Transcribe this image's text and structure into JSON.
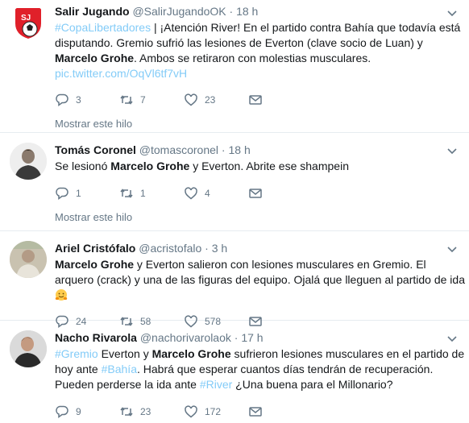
{
  "tweets": [
    {
      "name": "Salir Jugando",
      "handle": "@SalirJugandoOK",
      "sep": "·",
      "time": "18 h",
      "hashtag1": "#CopaLibertadores",
      "t1": " | ¡Atención River! En el partido contra Bahía que todavía está disputando. Gremio sufrió las lesiones de Everton (clave socio de Luan) y ",
      "bold1": "Marcelo Grohe",
      "t2": ". Ambos se retiraron con molestias musculares. ",
      "link": "pic.twitter.com/OqVl6tf7vH",
      "replies": "3",
      "retweets": "7",
      "likes": "23",
      "show_thread": "Mostrar este hilo",
      "avatar_text": "SJ"
    },
    {
      "name": "Tomás Coronel",
      "handle": "@tomascoronel",
      "sep": "·",
      "time": "18 h",
      "t1": "Se lesionó ",
      "bold1": "Marcelo Grohe",
      "t2": " y Everton. Abrite ese shampein",
      "replies": "1",
      "retweets": "1",
      "likes": "4",
      "show_thread": "Mostrar este hilo"
    },
    {
      "name": "Ariel Cristófalo",
      "handle": "@acristofalo",
      "sep": "·",
      "time": "3 h",
      "bold1": "Marcelo Grohe",
      "t1": " y Everton salieron con lesiones musculares en Gremio. El arquero (crack) y una de las figuras del equipo. Ojalá que lleguen al partido de ida ",
      "emoji": "hugging-face",
      "replies": "24",
      "retweets": "58",
      "likes": "578"
    },
    {
      "name": "Nacho Rivarola",
      "handle": "@nachorivarolaok",
      "sep": "·",
      "time": "17 h",
      "hashtag1": "#Gremio",
      "t1": " Everton y ",
      "bold1": "Marcelo Grohe",
      "t2": " sufrieron lesiones musculares en el partido de hoy ante ",
      "hashtag2": "#Bahía",
      "t3": ". Habrá que esperar cuantos días tendrán de recuperación. Pueden perderse la ida ante ",
      "hashtag3": "#River",
      "t4": " ¿Una buena para el Millonario?",
      "replies": "9",
      "retweets": "23",
      "likes": "172"
    }
  ],
  "colors": {
    "link": "#1da1f2",
    "muted": "#657786",
    "border": "#e6ecf0",
    "salir_red": "#e0202a"
  }
}
